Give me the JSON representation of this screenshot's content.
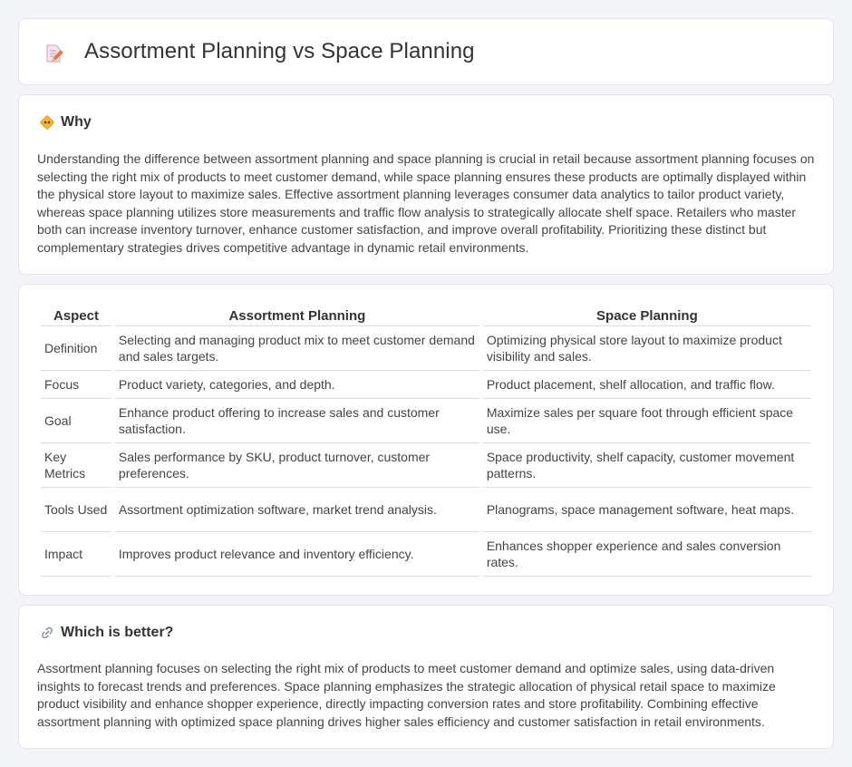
{
  "header": {
    "title": "Assortment Planning vs Space Planning",
    "icon": "document-pencil-icon"
  },
  "why": {
    "title": "Why",
    "icon": "diamond-sign-icon",
    "body": "Understanding the difference between assortment planning and space planning is crucial in retail because assortment planning focuses on selecting the right mix of products to meet customer demand, while space planning ensures these products are optimally displayed within the physical store layout to maximize sales. Effective assortment planning leverages consumer data analytics to tailor product variety, whereas space planning utilizes store measurements and traffic flow analysis to strategically allocate shelf space. Retailers who master both can increase inventory turnover, enhance customer satisfaction, and improve overall profitability. Prioritizing these distinct but complementary strategies drives competitive advantage in dynamic retail environments."
  },
  "table": {
    "headers": [
      "Aspect",
      "Assortment Planning",
      "Space Planning"
    ],
    "rows": [
      [
        "Definition",
        "Selecting and managing product mix to meet customer demand and sales targets.",
        "Optimizing physical store layout to maximize product visibility and sales."
      ],
      [
        "Focus",
        "Product variety, categories, and depth.",
        "Product placement, shelf allocation, and traffic flow."
      ],
      [
        "Goal",
        "Enhance product offering to increase sales and customer satisfaction.",
        "Maximize sales per square foot through efficient space use."
      ],
      [
        "Key Metrics",
        "Sales performance by SKU, product turnover, customer preferences.",
        "Space productivity, shelf capacity, customer movement patterns."
      ],
      [
        "Tools Used",
        "Assortment optimization software, market trend analysis.",
        "Planograms, space management software, heat maps."
      ],
      [
        "Impact",
        "Improves product relevance and inventory efficiency.",
        "Enhances shopper experience and sales conversion rates."
      ]
    ]
  },
  "better": {
    "title": "Which is better?",
    "icon": "link-icon",
    "body": "Assortment planning focuses on selecting the right mix of products to meet customer demand and optimize sales, using data-driven insights to forecast trends and preferences. Space planning emphasizes the strategic allocation of physical retail space to maximize product visibility and enhance shopper experience, directly impacting conversion rates and store profitability. Combining effective assortment planning with optimized space planning drives higher sales efficiency and customer satisfaction in retail environments."
  }
}
